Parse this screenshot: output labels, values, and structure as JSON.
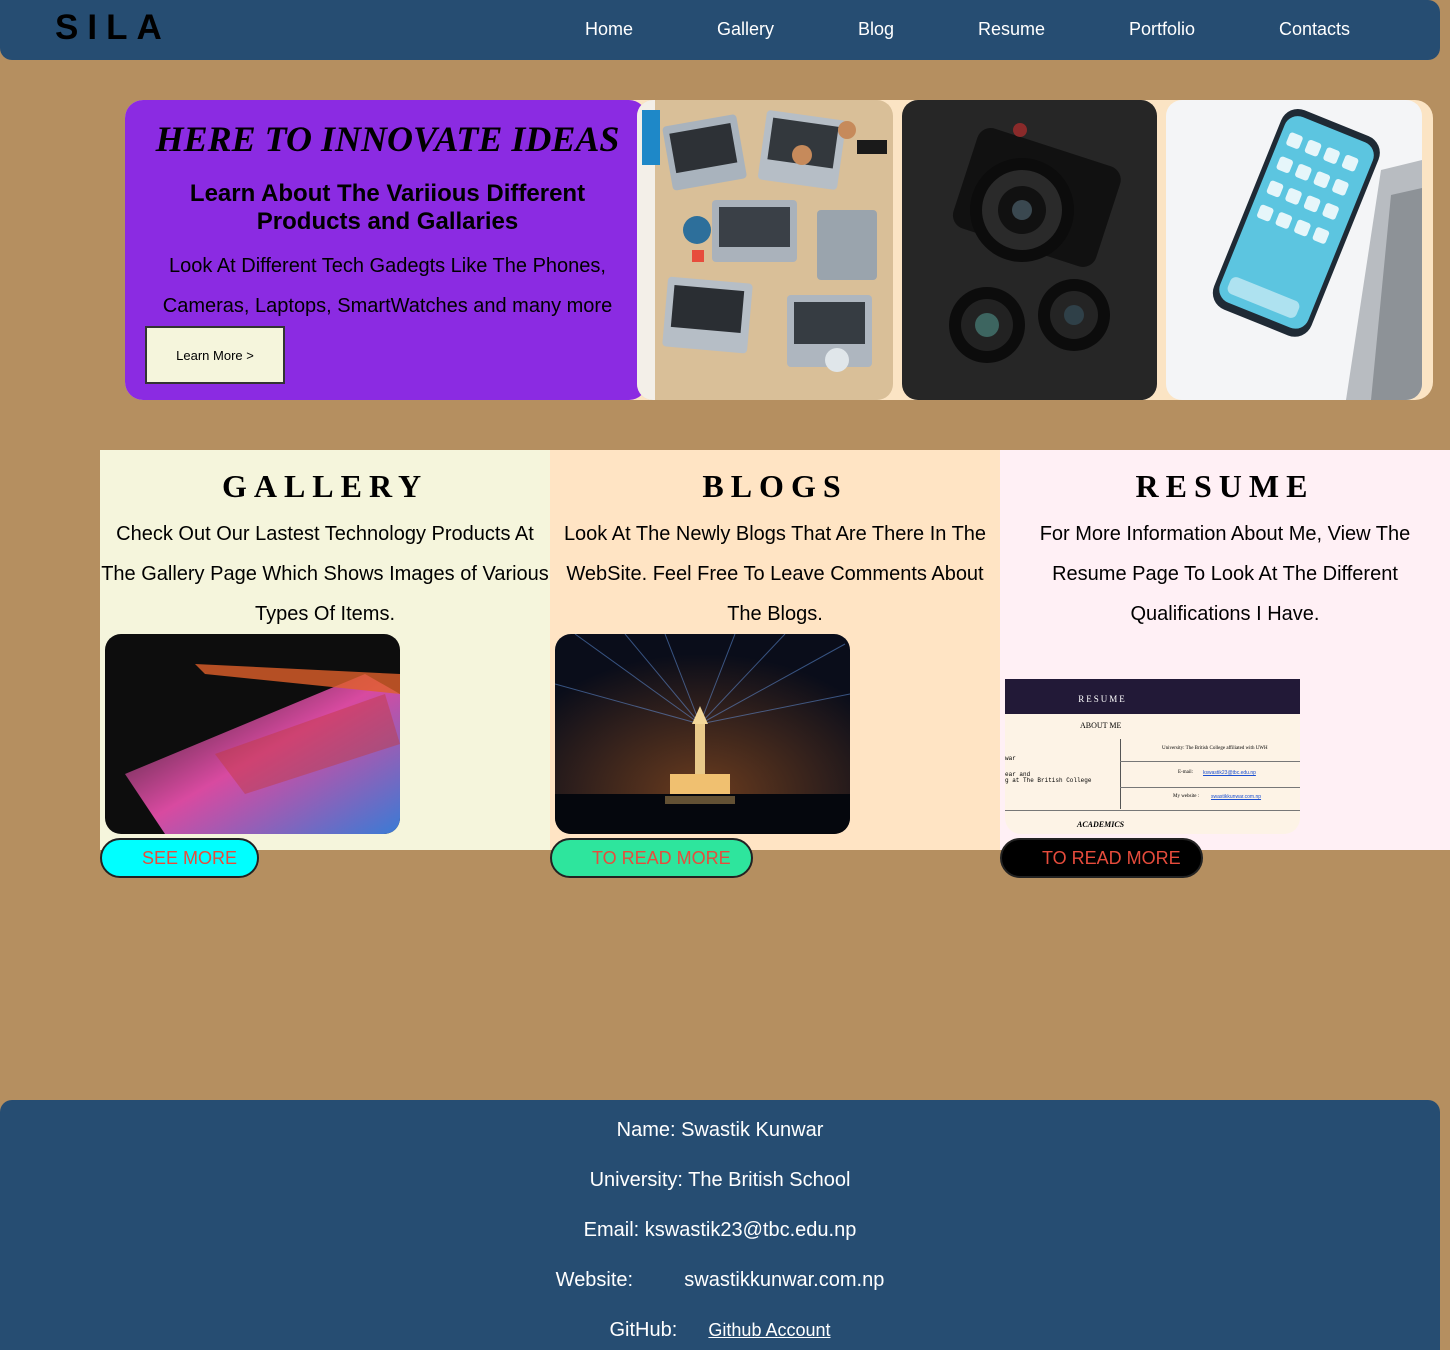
{
  "header": {
    "brand": "SILA",
    "nav": [
      "Home",
      "Gallery",
      "Blog",
      "Resume",
      "Portfolio",
      "Contacts"
    ]
  },
  "hero": {
    "title": "HERE TO INNOVATE IDEAS",
    "subtitle": "Learn About The Variious Different Products and Gallaries",
    "description": "Look At Different Tech Gadegts Like The Phones, Cameras, Laptops, SmartWatches and many more",
    "button": "Learn More >"
  },
  "cards": [
    {
      "title": "GALLERY",
      "text": "Check Out Our Lastest Technology Products At The Gallery Page Which Shows Images of Various Types Of Items.",
      "button": "SEE MORE"
    },
    {
      "title": "BLOGS",
      "text": "Look At The Newly Blogs That Are There In The WebSite. Feel Free To Leave Comments About The Blogs.",
      "button": "TO READ MORE"
    },
    {
      "title": "RESUME",
      "text": "For More Information About Me, View The Resume Page To Look At The Different Qualifications I Have.",
      "button": "TO READ MORE"
    }
  ],
  "resume_thumb": {
    "heading": "RESUME",
    "about": "ABOUT ME",
    "left_lines": [
      "war",
      "ear and",
      "g at The British College"
    ],
    "university": "University: The British College affiliated with UWH",
    "email_label": "E-mail:",
    "email": "kswastik23@tbc.edu.np",
    "website_label": "My website :",
    "website": "swastikkunwar.com.np",
    "academics": "ACADEMICS"
  },
  "footer": {
    "name": "Name: Swastik Kunwar",
    "university": "University: The British School",
    "email": "Email: kswastik23@tbc.edu.np",
    "website_label": "Website:",
    "website": "swastikkunwar.com.np",
    "github_label": "GitHub:",
    "github_link": "Github Account"
  },
  "colors": {
    "page_bg": "#b58f60",
    "nav_bg": "#264d72",
    "hero_purple": "#8b2be2",
    "gallery_bg": "#f5f5dc",
    "blogs_bg": "#ffe4c4",
    "resume_bg": "#fff0f5",
    "see_more_bg": "#00ffff",
    "read_more_bg": "#2ee59d",
    "read_more_dark_bg": "#000000",
    "pill_text": "#e74c3c"
  }
}
